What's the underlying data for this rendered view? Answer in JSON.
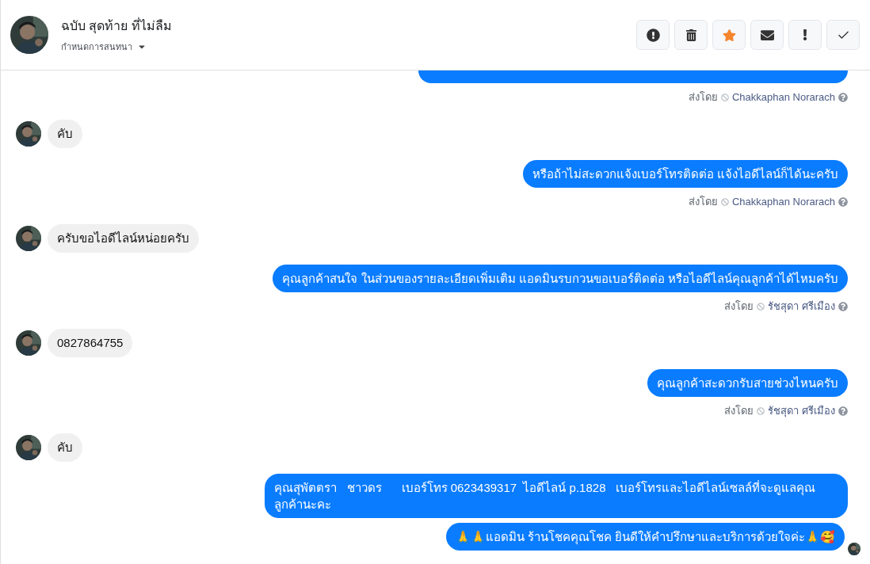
{
  "header": {
    "title": "ฉบับ สุดท้าย ที่ไม่ลืม",
    "subtitle": "กำหนดการสนทนา"
  },
  "messages": [
    {
      "kind": "cut"
    },
    {
      "kind": "sent_by",
      "label": "ส่งโดย",
      "sender": "Chakkaphan Norarach"
    },
    {
      "kind": "received",
      "text": "คับ"
    },
    {
      "kind": "sent",
      "text": "หรือถ้าไม่สะดวกแจ้งเบอร์โทรติดต่อ แจ้งไอดีไลน์ก็ได้นะครับ"
    },
    {
      "kind": "sent_by",
      "label": "ส่งโดย",
      "sender": "Chakkaphan Norarach"
    },
    {
      "kind": "received",
      "text": "ครับขอไอดีไลน์หน่อยครับ"
    },
    {
      "kind": "sent",
      "text": "คุณลูกค้าสนใจ ในส่วนของรายละเอียดเพิ่มเติม แอดมินรบกวนขอเบอร์ติดต่อ หรือไอดีไลน์คุณลูกค้าได้ไหมครับ"
    },
    {
      "kind": "sent_by",
      "label": "ส่งโดย",
      "sender": "รัชสุดา ศรีเมือง"
    },
    {
      "kind": "received",
      "text": "0827864755"
    },
    {
      "kind": "sent",
      "text": "คุณลูกค้าสะดวกรับสายช่วงไหนครับ"
    },
    {
      "kind": "sent_by",
      "label": "ส่งโดย",
      "sender": "รัชสุดา ศรีเมือง"
    },
    {
      "kind": "received",
      "text": "คับ"
    },
    {
      "kind": "sent",
      "text": "คุณสุพัตตรา   ชาวดร      เบอร์โทร 0623439317  ไอดีไลน์ p.1828   เบอร์โทรและไอดีไลน์เซลล์ที่จะดูแลคุณลูกค้านะคะ"
    },
    {
      "kind": "sent_seen",
      "text": "🙏🙏แอดมิน ร้านโชคคุณโชค ยินดีให้คำปรึกษาและบริการด้วยใจค่ะ🙏🥰"
    }
  ]
}
